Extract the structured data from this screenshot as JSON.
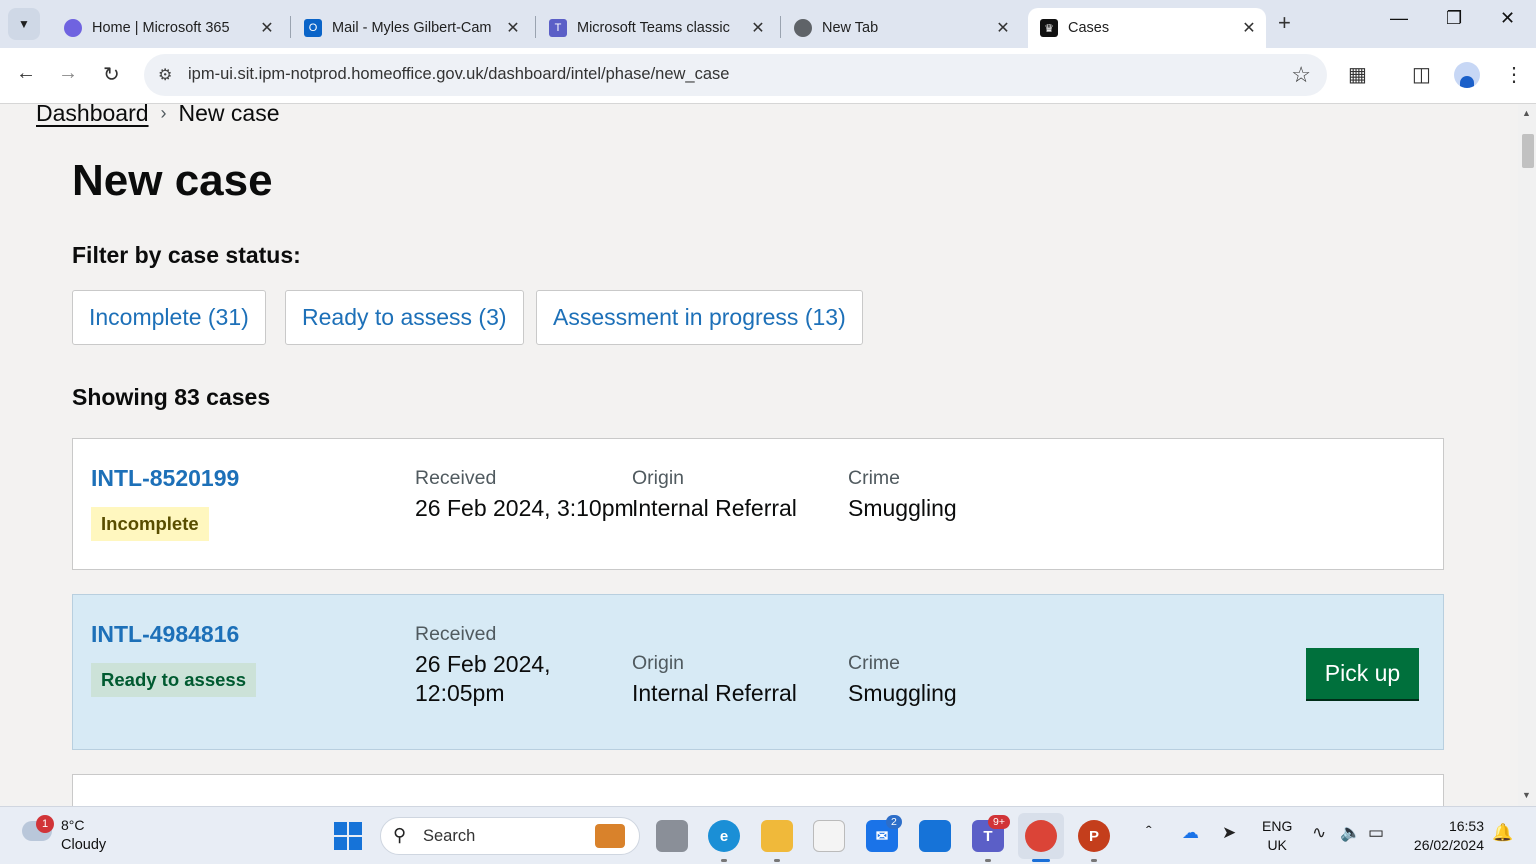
{
  "browser": {
    "tabs": [
      {
        "title": "Home | Microsoft 365",
        "icon": "microsoft365-icon",
        "active": false
      },
      {
        "title": "Mail - Myles Gilbert-Cam",
        "icon": "outlook-icon",
        "active": false
      },
      {
        "title": "Microsoft Teams classic",
        "icon": "teams-icon",
        "active": false
      },
      {
        "title": "New Tab",
        "icon": "chrome-icon",
        "active": false
      },
      {
        "title": "Cases",
        "icon": "crown-icon",
        "active": true
      }
    ],
    "url": "ipm-ui.sit.ipm-notprod.homeoffice.gov.uk/dashboard/intel/phase/new_case"
  },
  "breadcrumb": {
    "home": "Dashboard",
    "current": "New case"
  },
  "page": {
    "title": "New case",
    "filter_label": "Filter by case status:",
    "filters": [
      {
        "label": "Incomplete (31)"
      },
      {
        "label": "Ready to assess (3)"
      },
      {
        "label": "Assessment in progress (13)"
      }
    ],
    "showing": "Showing 83 cases"
  },
  "cases": [
    {
      "id": "INTL-8520199",
      "status": "Incomplete",
      "received_label": "Received",
      "received": "26 Feb 2024, 3:10pm",
      "origin_label": "Origin",
      "origin": "Internal Referral",
      "crime_label": "Crime",
      "crime": "Smuggling"
    },
    {
      "id": "INTL-4984816",
      "status": "Ready to assess",
      "received_label": "Received",
      "received": "26 Feb 2024, 12:05pm",
      "origin_label": "Origin",
      "origin": "Internal Referral",
      "crime_label": "Crime",
      "crime": "Smuggling",
      "action": "Pick up"
    }
  ],
  "taskbar": {
    "weather_temp": "8°C",
    "weather_condition": "Cloudy",
    "weather_badge": "1",
    "search_placeholder": "Search",
    "mail_badge": "2",
    "teams_badge": "9+",
    "lang_top": "ENG",
    "lang_bottom": "UK",
    "time": "16:53",
    "date": "26/02/2024"
  },
  "colors": {
    "link": "#1d70b8",
    "pickup_button": "#00703c",
    "tag_incomplete_bg": "#fff7bf",
    "tag_ready_bg": "#cce2d8",
    "highlight_card": "#d7eaf5"
  }
}
